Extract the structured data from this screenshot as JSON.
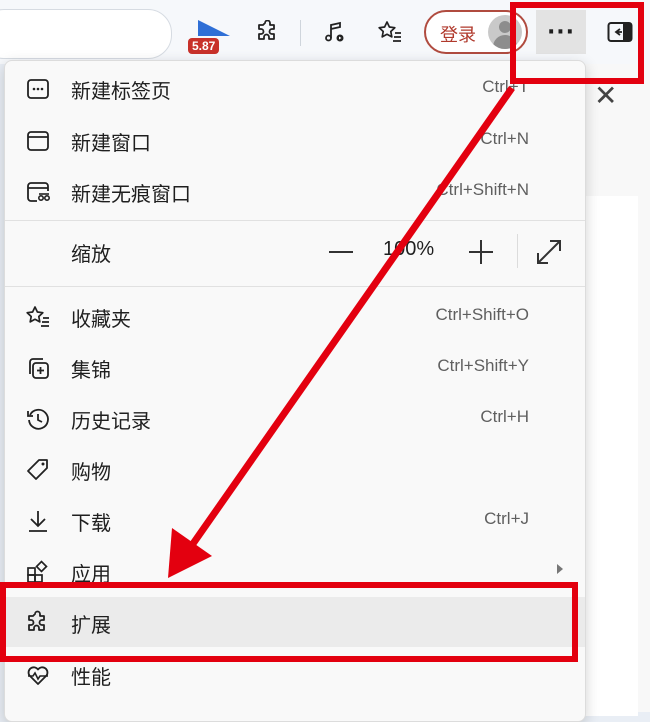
{
  "toolbar": {
    "badge_value": "5.87",
    "login_label": "登录",
    "more_label": "···",
    "icons": [
      "media-badge-icon",
      "extensions-icon",
      "music-icon",
      "favorites-icon",
      "avatar-icon",
      "more-icon",
      "sidebar-icon"
    ]
  },
  "menu": {
    "items": [
      {
        "label": "新建标签页",
        "shortcut": "Ctrl+T",
        "icon": "new-tab-icon"
      },
      {
        "label": "新建窗口",
        "shortcut": "Ctrl+N",
        "icon": "new-window-icon"
      },
      {
        "label": "新建无痕窗口",
        "shortcut": "Ctrl+Shift+N",
        "icon": "inprivate-icon"
      },
      {
        "label": "缩放",
        "zoom_value": "100%"
      },
      {
        "label": "收藏夹",
        "shortcut": "Ctrl+Shift+O",
        "icon": "favorites-icon"
      },
      {
        "label": "集锦",
        "shortcut": "Ctrl+Shift+Y",
        "icon": "collections-icon"
      },
      {
        "label": "历史记录",
        "shortcut": "Ctrl+H",
        "icon": "history-icon"
      },
      {
        "label": "购物",
        "icon": "shopping-tag-icon"
      },
      {
        "label": "下载",
        "shortcut": "Ctrl+J",
        "icon": "download-icon"
      },
      {
        "label": "应用",
        "icon": "apps-icon"
      },
      {
        "label": "扩展",
        "icon": "extensions-icon"
      },
      {
        "label": "性能",
        "icon": "performance-icon"
      }
    ],
    "zoom_minus": "—",
    "zoom_plus": "+"
  },
  "colors": {
    "annotation": "#e3000f",
    "highlight": "#ebebeb",
    "login_accent": "#b0392c",
    "badge": "#c8312a"
  }
}
